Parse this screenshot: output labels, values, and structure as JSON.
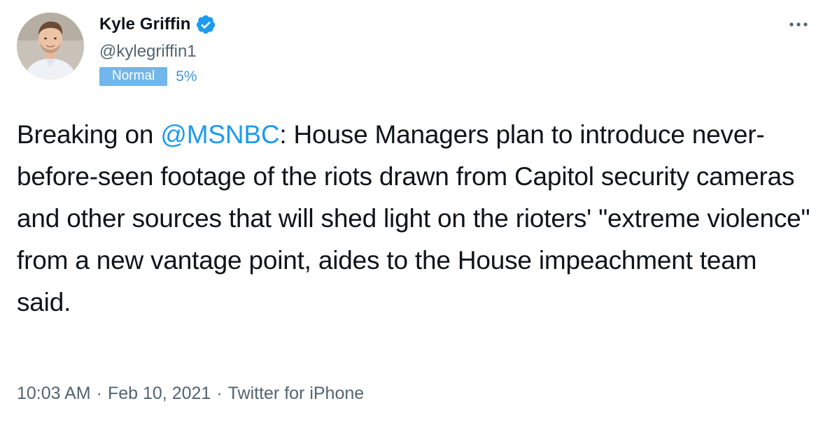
{
  "author": {
    "display_name": "Kyle Griffin",
    "handle": "@kylegriffin1",
    "verified": true,
    "avatar_icon": "person-avatar"
  },
  "badge": {
    "label": "Normal",
    "percent": "5%",
    "color": "#71b7ec"
  },
  "tweet": {
    "text_before_mention": "Breaking on ",
    "mention": "@MSNBC",
    "text_after_mention": ": House Managers plan to introduce never-before-seen footage of the riots drawn from Capitol security cameras and other sources that will shed light on the rioters' \"extreme violence\" from a new vantage point, aides to the House impeachment team said."
  },
  "meta": {
    "time": "10:03 AM",
    "separator": "·",
    "date": "Feb 10, 2021",
    "source": "Twitter for iPhone"
  },
  "colors": {
    "link": "#1d9bf0",
    "verified": "#1d9bf0",
    "secondary_text": "#536471"
  }
}
